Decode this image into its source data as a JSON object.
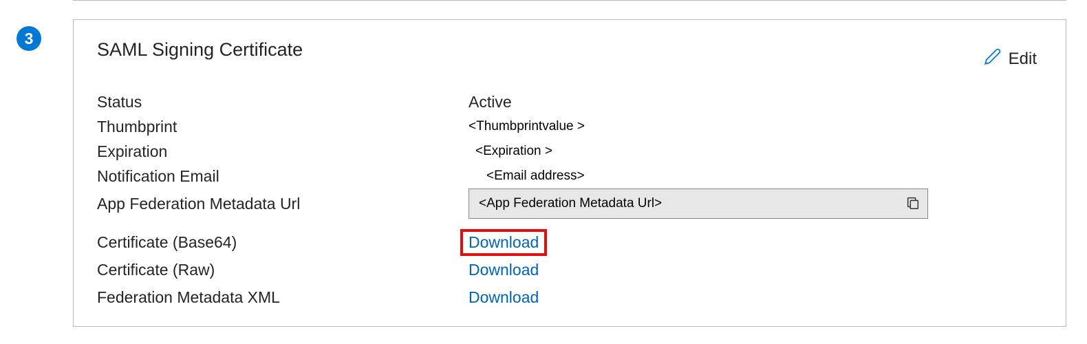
{
  "step": {
    "number": "3"
  },
  "card": {
    "title": "SAML Signing Certificate",
    "edit_label": "Edit",
    "fields": {
      "status": {
        "label": "Status",
        "value": "Active"
      },
      "thumbprint": {
        "label": "Thumbprint",
        "value": "<Thumbprintvalue >"
      },
      "expiration": {
        "label": "Expiration",
        "value": "<Expiration >"
      },
      "notification_email": {
        "label": "Notification Email",
        "value": "<Email address>"
      },
      "federation_url": {
        "label": "App Federation Metadata Url",
        "value": "<App Federation Metadata Url>"
      },
      "cert_base64": {
        "label": "Certificate (Base64)",
        "action": "Download"
      },
      "cert_raw": {
        "label": "Certificate (Raw)",
        "action": "Download"
      },
      "metadata_xml": {
        "label": "Federation Metadata XML",
        "action": "Download"
      }
    }
  }
}
